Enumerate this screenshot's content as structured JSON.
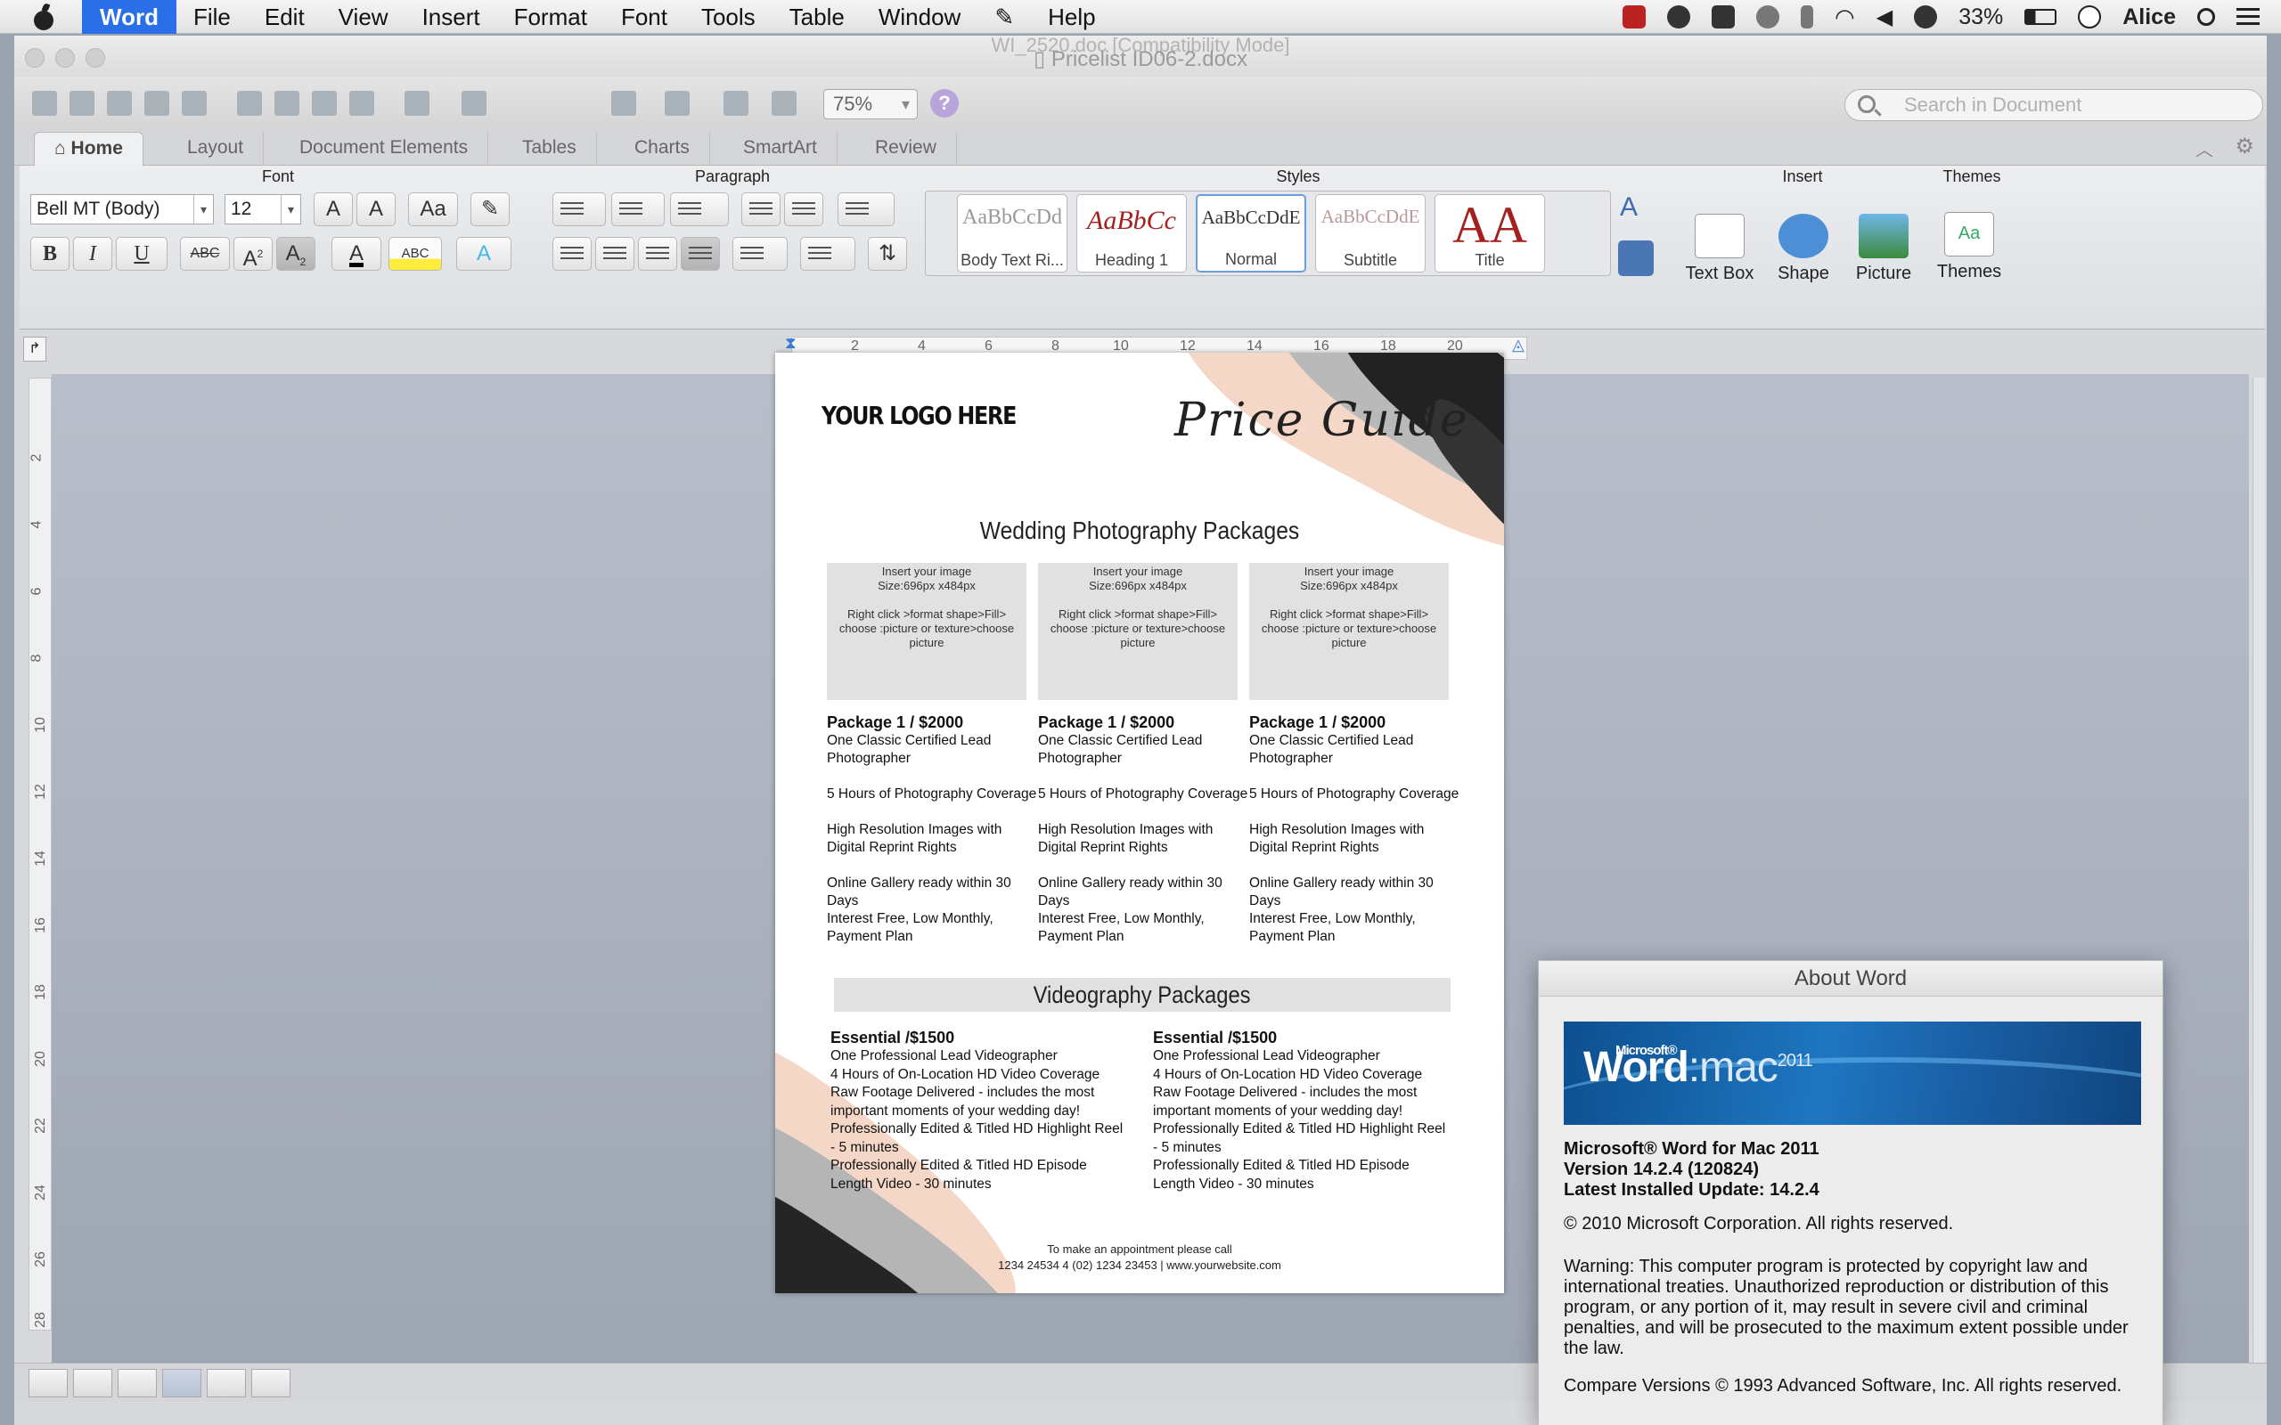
{
  "menubar": {
    "app": "Word",
    "items": [
      "File",
      "Edit",
      "View",
      "Insert",
      "Format",
      "Font",
      "Tools",
      "Table",
      "Window",
      "Help"
    ],
    "battery": "33%",
    "user": "Alice"
  },
  "window": {
    "title": "Pricelist ID06-2.docx",
    "background_title": "WI_2520.doc [Compatibility Mode]"
  },
  "toolbar": {
    "zoom": "75%",
    "help": "?",
    "search_placeholder": "Search in Document"
  },
  "tabs": [
    "Home",
    "Layout",
    "Document Elements",
    "Tables",
    "Charts",
    "SmartArt",
    "Review"
  ],
  "ribbon": {
    "groups": {
      "font": "Font",
      "paragraph": "Paragraph",
      "styles": "Styles",
      "insert": "Insert",
      "themes": "Themes"
    },
    "font_name": "Bell MT (Body)",
    "font_size": "12",
    "styles": [
      {
        "preview": "AaBbCcDd",
        "name": "Body Text Ri..."
      },
      {
        "preview": "AaBbCc",
        "name": "Heading 1"
      },
      {
        "preview": "AaBbCcDdE",
        "name": "Normal"
      },
      {
        "preview": "AaBbCcDdE",
        "name": "Subtitle"
      },
      {
        "preview": "AA",
        "name": "Title"
      }
    ],
    "insert": [
      "Text Box",
      "Shape",
      "Picture"
    ],
    "themes": "Themes",
    "button_glyphs": {
      "bold": "B",
      "italic": "I",
      "underline": "U",
      "strike": "ABC",
      "superscript": "A",
      "subscript": "A",
      "font_color": "A",
      "highlight": "ABC",
      "text_effects": "A",
      "grow": "A",
      "shrink": "A",
      "change_case": "Aa",
      "theme_preview": "Aa"
    }
  },
  "ruler": {
    "h_marks": [
      "2",
      "4",
      "6",
      "8",
      "10",
      "12",
      "14",
      "16",
      "18",
      "20"
    ],
    "v_marks": [
      "2",
      "4",
      "6",
      "8",
      "10",
      "12",
      "14",
      "16",
      "18",
      "20",
      "22",
      "24",
      "26",
      "28"
    ]
  },
  "document": {
    "logo": "YOUR LOGO HERE",
    "title": "Price Guide",
    "wedding_heading": "Wedding Photography Packages",
    "image_placeholder": {
      "line1": "Insert your image",
      "line2": "Size:696px x484px",
      "line3": "Right click >format shape>Fill> choose :picture or texture>choose picture"
    },
    "packages": [
      {
        "title": "Package 1 / $2000",
        "lines": [
          "One Classic Certified Lead Photographer",
          "5 Hours of Photography Coverage",
          "High Resolution Images with Digital Reprint Rights",
          "Online Gallery ready within 30 Days",
          "Interest Free, Low Monthly, Payment Plan"
        ]
      },
      {
        "title": "Package 1 / $2000",
        "lines": [
          "One Classic Certified Lead Photographer",
          "5 Hours of Photography Coverage",
          "High Resolution Images with Digital Reprint Rights",
          "Online Gallery ready within 30 Days",
          "Interest Free, Low Monthly, Payment Plan"
        ]
      },
      {
        "title": "Package 1 / $2000",
        "lines": [
          "One Classic Certified Lead Photographer",
          "5 Hours of Photography Coverage",
          "High Resolution Images with Digital Reprint Rights",
          "Online Gallery ready within 30 Days",
          "Interest Free, Low Monthly, Payment Plan"
        ]
      }
    ],
    "video_heading": "Videography Packages",
    "video_packages": [
      {
        "title": "Essential /$1500",
        "lines": [
          "One Professional Lead Videographer",
          "4 Hours of On-Location HD Video Coverage",
          "Raw Footage Delivered - includes the most important moments of your wedding day!",
          "Professionally Edited & Titled HD Highlight Reel - 5 minutes",
          "Professionally Edited & Titled HD Episode Length Video - 30 minutes"
        ]
      },
      {
        "title": "Essential /$1500",
        "lines": [
          "One Professional Lead Videographer",
          "4 Hours of On-Location HD Video Coverage",
          "Raw Footage Delivered - includes the most important moments of your wedding day!",
          "Professionally Edited & Titled HD Highlight Reel - 5 minutes",
          "Professionally Edited & Titled HD Episode Length Video - 30 minutes"
        ]
      }
    ],
    "footer_line1": "To make an appointment please call",
    "footer_line2": "1234 24534 4 (02) 1234 23453 | www.yourwebsite.com"
  },
  "about": {
    "title": "About Word",
    "banner_ms": "Microsoft®",
    "banner_word": "Word",
    "banner_mac": ":mac",
    "banner_year": "2011",
    "product": "Microsoft® Word for Mac 2011",
    "version": "Version 14.2.4 (120824)",
    "update": "Latest Installed Update: 14.2.4",
    "copyright": "© 2010 Microsoft Corporation. All rights reserved.",
    "warning": "Warning: This computer program is protected by copyright law and international treaties.  Unauthorized reproduction or distribution of this program, or any portion of it, may result in severe civil and criminal penalties, and will be prosecuted to the maximum extent possible under the law.",
    "compare": "Compare Versions © 1993 Advanced Software, Inc.  All rights reserved."
  }
}
